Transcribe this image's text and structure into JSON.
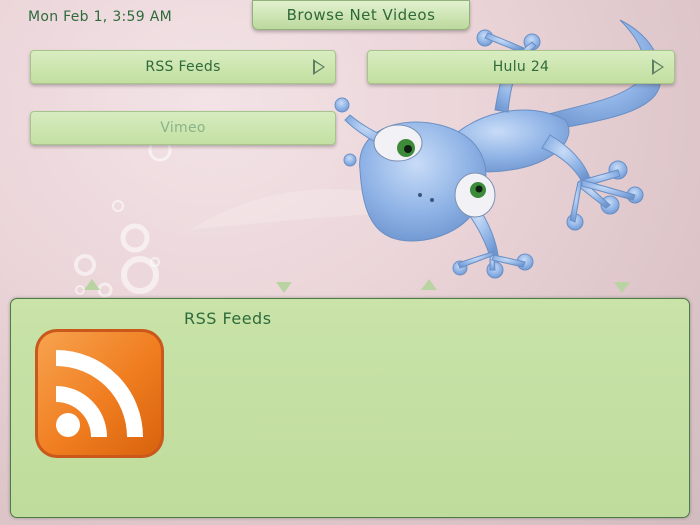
{
  "clock": "Mon Feb 1, 3:59 AM",
  "title": "Browse Net Videos",
  "menu": [
    {
      "label": "RSS Feeds"
    },
    {
      "label": "Hulu 24"
    },
    {
      "label": "Vimeo"
    }
  ],
  "detail": {
    "title": "RSS Feeds",
    "icon": "rss-icon"
  },
  "colors": {
    "accent_text": "#2e6a3c",
    "button_green": "#c2df9f",
    "panel_green": "#c4df a3",
    "rss_orange": "#f07d1f"
  }
}
